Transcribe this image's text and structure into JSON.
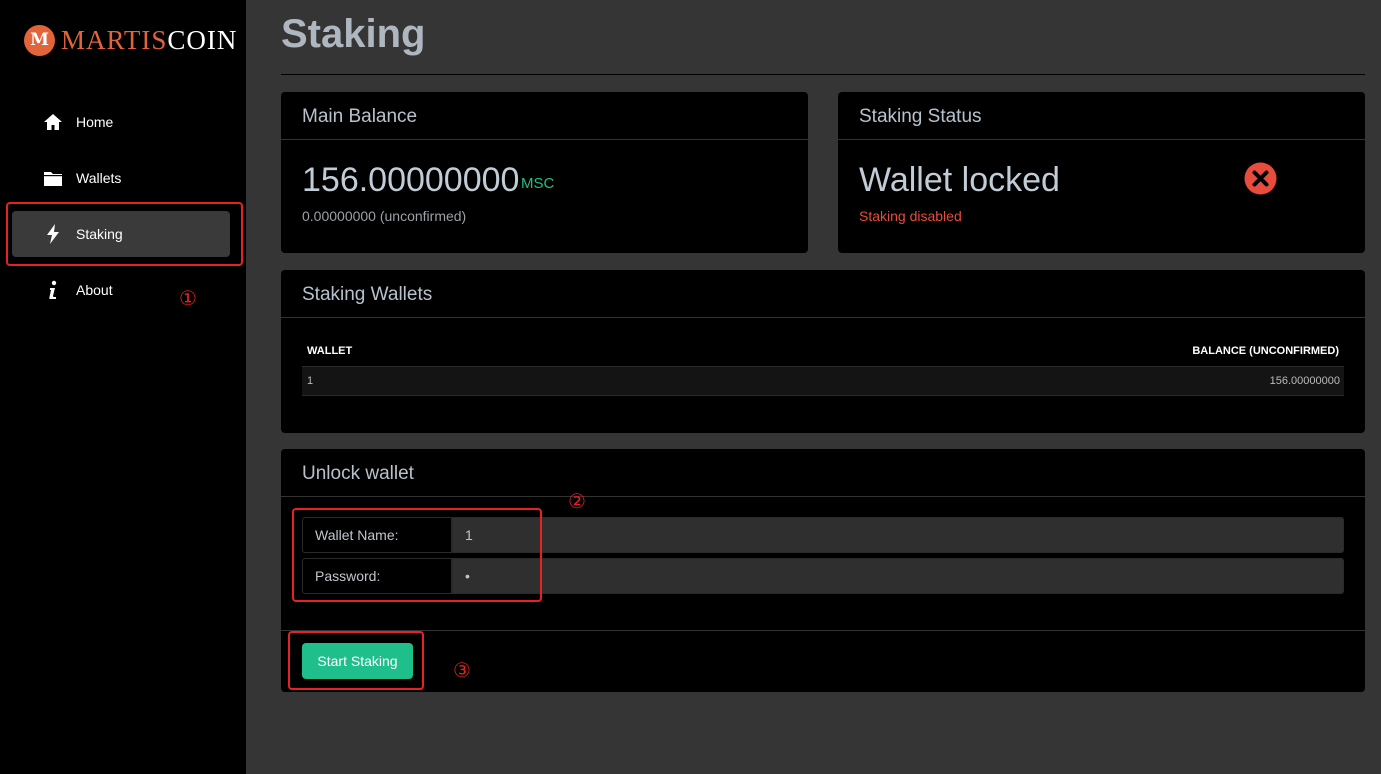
{
  "brand": {
    "part1": "MARTIS",
    "part2": "COIN",
    "logo_letter": "M",
    "accent": "#e2643b"
  },
  "sidebar": {
    "items": [
      {
        "label": "Home",
        "icon": "home-icon"
      },
      {
        "label": "Wallets",
        "icon": "folder-icon"
      },
      {
        "label": "Staking",
        "icon": "lightning-icon",
        "active": true
      },
      {
        "label": "About",
        "icon": "info-icon"
      }
    ]
  },
  "page": {
    "title": "Staking"
  },
  "main_balance": {
    "title": "Main Balance",
    "amount": "156.00000000",
    "unit": "MSC",
    "unconfirmed": "0.00000000 (unconfirmed)"
  },
  "staking_status": {
    "title": "Staking Status",
    "status": "Wallet locked",
    "detail": "Staking disabled",
    "icon": "error-x-icon",
    "status_color": "#e74c3c"
  },
  "staking_wallets": {
    "title": "Staking Wallets",
    "columns": [
      "WALLET",
      "BALANCE (UNCONFIRMED)"
    ],
    "rows": [
      {
        "wallet": "1",
        "balance": "156.00000000"
      }
    ]
  },
  "unlock_wallet": {
    "title": "Unlock wallet",
    "wallet_name_label": "Wallet Name:",
    "wallet_name_value": "1",
    "password_label": "Password:",
    "password_value": "•",
    "button_label": "Start Staking",
    "button_color": "#1fbf8b"
  },
  "annotations": [
    "①",
    "②",
    "③"
  ]
}
